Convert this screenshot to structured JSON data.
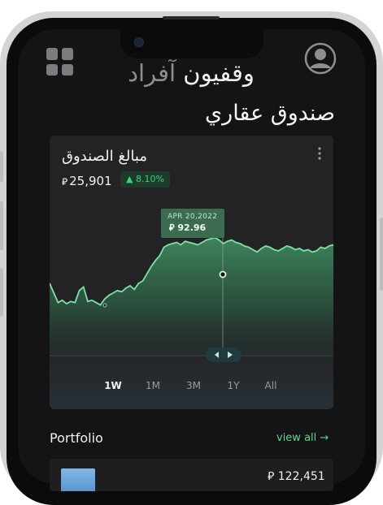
{
  "header": {
    "title_part1": "وقفيون",
    "title_part2": "آفراد",
    "page_heading": "صندوق عقاري"
  },
  "fund_card": {
    "label": "مبالغ الصندوق",
    "currency_symbol": "⃁",
    "amount": "25,901",
    "change": "▲ 8.10%",
    "tooltip_date": "APR 20,2022",
    "tooltip_value": "92.96",
    "ranges": [
      "1W",
      "1M",
      "3M",
      "1Y",
      "All"
    ],
    "active_range": "1W"
  },
  "chart_data": {
    "type": "area",
    "series": [
      {
        "values": [
          60,
          52,
          44,
          46,
          43,
          45,
          44,
          54,
          57,
          45,
          46,
          44,
          42,
          47,
          50,
          52,
          54,
          53,
          56,
          58,
          55,
          60,
          62,
          68,
          74,
          79,
          83,
          90,
          92,
          93,
          94,
          92,
          95,
          94,
          93,
          92,
          94,
          96,
          97,
          98,
          96,
          93,
          95,
          96,
          94,
          93,
          91,
          90,
          88,
          86,
          89,
          91,
          90,
          88,
          87,
          89,
          91,
          90,
          88,
          89,
          87,
          88,
          86,
          87,
          90,
          89,
          91,
          92
        ]
      }
    ],
    "tooltip": {
      "date": "APR 20,2022",
      "value": 92.96
    },
    "ylim": [
      0,
      120
    ],
    "line_color": "#7fe0a4",
    "fill_color": "#3f8a5f"
  },
  "portfolio": {
    "title": "Portfolio",
    "view_all": "view all →",
    "first_value": "⃁ 122,451"
  },
  "colors": {
    "screen_bg": "#141416",
    "card_bg": "#212123",
    "accent_green": "#56d98a"
  },
  "icons": {
    "apps": "grid-icon",
    "profile": "profile-icon",
    "more": "more-vertical-icon"
  }
}
